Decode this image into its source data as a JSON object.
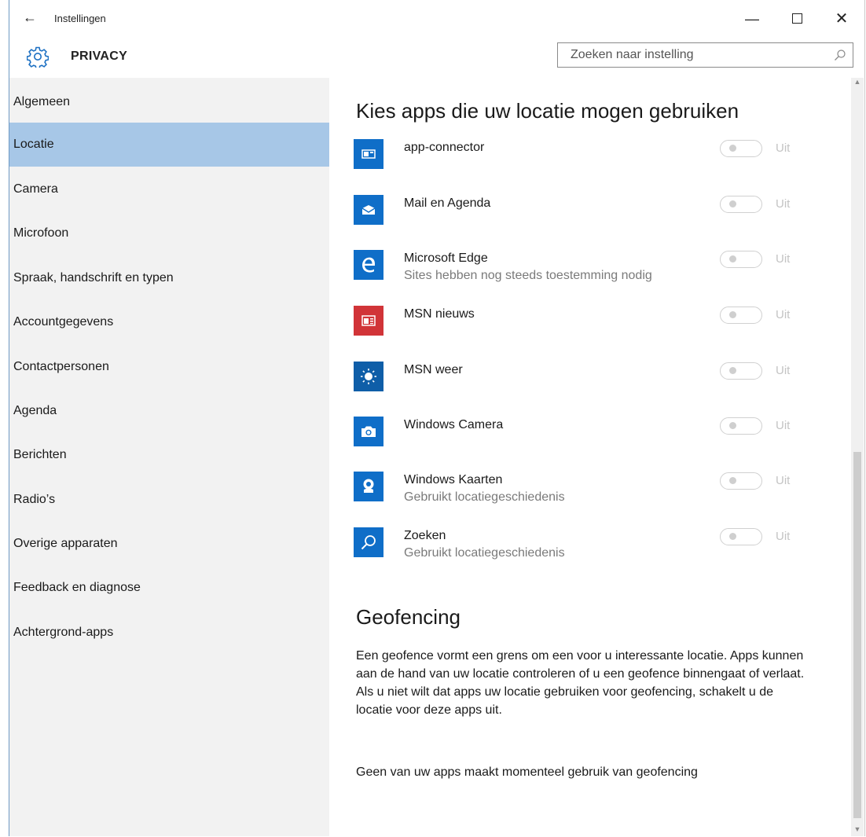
{
  "window": {
    "title": "Instellingen",
    "back_icon": "arrow-left-icon",
    "minimize_glyph": "—",
    "close_glyph": "✕"
  },
  "header": {
    "section_title": "PRIVACY",
    "icon": "gear-icon",
    "search_placeholder": "Zoeken naar instelling"
  },
  "sidebar": {
    "selected_index": 1,
    "items": [
      {
        "label": "Algemeen"
      },
      {
        "label": "Locatie"
      },
      {
        "label": "Camera"
      },
      {
        "label": "Microfoon"
      },
      {
        "label": "Spraak, handschrift en typen"
      },
      {
        "label": "Accountgegevens"
      },
      {
        "label": "Contactpersonen"
      },
      {
        "label": "Agenda"
      },
      {
        "label": "Berichten"
      },
      {
        "label": "Radio’s"
      },
      {
        "label": "Overige apparaten"
      },
      {
        "label": "Feedback en diagnose"
      },
      {
        "label": "Achtergrond-apps"
      }
    ]
  },
  "main": {
    "heading": "Kies apps die uw locatie mogen gebruiken",
    "apps": [
      {
        "name": "app-connector",
        "sub": "",
        "state": "Uit",
        "icon": "app-connector-icon",
        "color": "#0f6ec8"
      },
      {
        "name": "Mail en Agenda",
        "sub": "",
        "state": "Uit",
        "icon": "mail-icon",
        "color": "#0f6ec8"
      },
      {
        "name": "Microsoft Edge",
        "sub": "Sites hebben nog steeds toestemming nodig",
        "state": "Uit",
        "icon": "edge-icon",
        "color": "#0f6ec8"
      },
      {
        "name": "MSN nieuws",
        "sub": "",
        "state": "Uit",
        "icon": "news-icon",
        "color": "#d13438"
      },
      {
        "name": "MSN weer",
        "sub": "",
        "state": "Uit",
        "icon": "weather-sun-icon",
        "color": "#0f5ea8"
      },
      {
        "name": "Windows Camera",
        "sub": "",
        "state": "Uit",
        "icon": "camera-icon",
        "color": "#0f6ec8"
      },
      {
        "name": "Windows Kaarten",
        "sub": "Gebruikt locatiegeschiedenis",
        "state": "Uit",
        "icon": "maps-icon",
        "color": "#0f6ec8"
      },
      {
        "name": "Zoeken",
        "sub": "Gebruikt locatiegeschiedenis",
        "state": "Uit",
        "icon": "search-app-icon",
        "color": "#0f6ec8"
      }
    ],
    "geofencing": {
      "title": "Geofencing",
      "description": "Een geofence vormt een grens om een voor u interessante locatie. Apps kunnen aan de hand van uw locatie controleren of u een geofence binnengaat of verlaat. Als u niet wilt dat apps uw locatie gebruiken voor geofencing, schakelt u de locatie voor deze apps uit.",
      "status": "Geen van uw apps maakt momenteel gebruik van geofencing"
    }
  },
  "colors": {
    "accent": "#0f6ec8",
    "selected_nav": "#a7c7e7",
    "sidebar_bg": "#f2f2f2"
  }
}
